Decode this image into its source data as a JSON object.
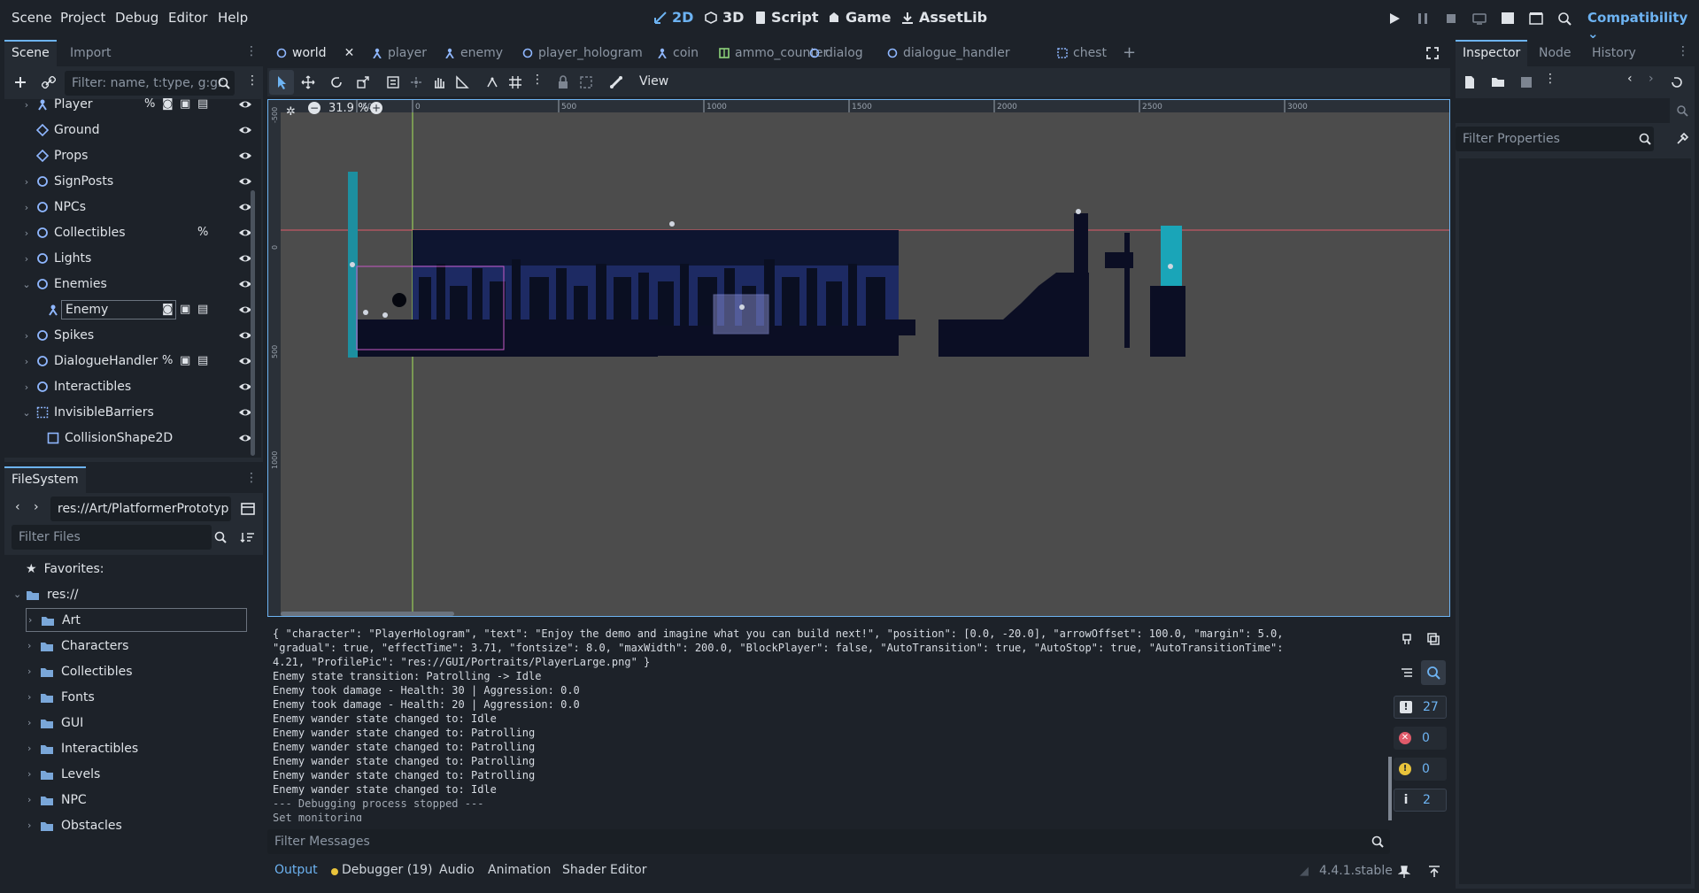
{
  "menu": [
    "Scene",
    "Project",
    "Debug",
    "Editor",
    "Help"
  ],
  "workspaces": [
    {
      "label": "2D",
      "active": true
    },
    {
      "label": "3D",
      "active": false
    },
    {
      "label": "Script",
      "active": false
    },
    {
      "label": "Game",
      "active": false
    },
    {
      "label": "AssetLib",
      "active": false
    }
  ],
  "renderer": "Compatibility",
  "scene_dock": {
    "tabs": [
      "Scene",
      "Import"
    ],
    "filter_placeholder": "Filter: name, t:type, g:gr",
    "nodes": [
      {
        "name": "Player",
        "indent": 0,
        "arrow": "›",
        "icon": "player"
      },
      {
        "name": "Ground",
        "indent": 0,
        "arrow": "",
        "icon": "tilemap"
      },
      {
        "name": "Props",
        "indent": 0,
        "arrow": "",
        "icon": "tilemap"
      },
      {
        "name": "SignPosts",
        "indent": 0,
        "arrow": "›",
        "icon": "node"
      },
      {
        "name": "NPCs",
        "indent": 0,
        "arrow": "›",
        "icon": "node"
      },
      {
        "name": "Collectibles",
        "indent": 0,
        "arrow": "›",
        "icon": "node"
      },
      {
        "name": "Lights",
        "indent": 0,
        "arrow": "›",
        "icon": "node"
      },
      {
        "name": "Enemies",
        "indent": 0,
        "arrow": "⌄",
        "icon": "node"
      },
      {
        "name": "Enemy",
        "indent": 1,
        "arrow": "",
        "icon": "player"
      },
      {
        "name": "Spikes",
        "indent": 0,
        "arrow": "›",
        "icon": "node"
      },
      {
        "name": "DialogueHandler",
        "indent": 0,
        "arrow": "›",
        "icon": "node"
      },
      {
        "name": "Interactibles",
        "indent": 0,
        "arrow": "›",
        "icon": "node"
      },
      {
        "name": "InvisibleBarriers",
        "indent": 0,
        "arrow": "⌄",
        "icon": "area"
      },
      {
        "name": "CollisionShape2D",
        "indent": 1,
        "arrow": "",
        "icon": "shape"
      }
    ]
  },
  "filesystem": {
    "tab": "FileSystem",
    "path": "res://Art/PlatformerPrototyp",
    "filter_placeholder": "Filter Files",
    "favorites": "Favorites:",
    "root": "res://",
    "folders": [
      "Art",
      "Characters",
      "Collectibles",
      "Fonts",
      "GUI",
      "Interactibles",
      "Levels",
      "NPC",
      "Obstacles"
    ]
  },
  "editor_tabs": [
    "world",
    "player",
    "enemy",
    "player_hologram",
    "coin",
    "ammo_counter",
    "dialog",
    "dialogue_handler",
    "chest"
  ],
  "toolbar": {
    "view_label": "View"
  },
  "viewport": {
    "zoom": "31.9 %",
    "ruler_labels": [
      "-500",
      "0",
      "500",
      "1000",
      "1500",
      "2000",
      "2500",
      "3000"
    ],
    "vruler_labels": [
      "-500",
      "0",
      "500",
      "1000"
    ]
  },
  "output": {
    "lines": [
      "{ \"character\": \"PlayerHologram\", \"text\": \"Enjoy the demo and imagine what you can build next!\", \"position\": [0.0, -20.0], \"arrowOffset\": 100.0, \"margin\": 5.0,",
      "\"gradual\": true, \"effectTime\": 3.71, \"fontsize\": 8.0, \"maxWidth\": 200.0, \"BlockPlayer\": false, \"AutoTransition\": true, \"AutoStop\": true, \"AutoTransitionTime\":",
      "4.21, \"ProfilePic\": \"res://GUI/Portraits/PlayerLarge.png\" }",
      "Enemy state transition: Patrolling -> Idle",
      "Enemy took damage - Health: 30 | Aggression: 0.0",
      "Enemy took damage - Health: 20 | Aggression: 0.0",
      "Enemy wander state changed to: Idle",
      "Enemy wander state changed to: Patrolling",
      "Enemy wander state changed to: Patrolling",
      "Enemy wander state changed to: Patrolling",
      "Enemy wander state changed to: Patrolling",
      "Enemy wander state changed to: Idle"
    ],
    "dim_lines": [
      "--- Debugging process stopped ---",
      "Set monitoring"
    ],
    "filter_placeholder": "Filter Messages",
    "counts": {
      "messages": "27",
      "errors": "0",
      "warnings": "0",
      "info": "2"
    }
  },
  "bottom_tabs": {
    "output": "Output",
    "debugger": "Debugger (19)",
    "audio": "Audio",
    "animation": "Animation",
    "shader": "Shader Editor"
  },
  "version": "4.4.1.stable",
  "inspector": {
    "tabs": [
      "Inspector",
      "Node",
      "History"
    ],
    "filter_placeholder": "Filter Properties"
  },
  "colors": {
    "accent": "#6db3f2",
    "bg": "#1d2229",
    "panel": "#252b33"
  }
}
